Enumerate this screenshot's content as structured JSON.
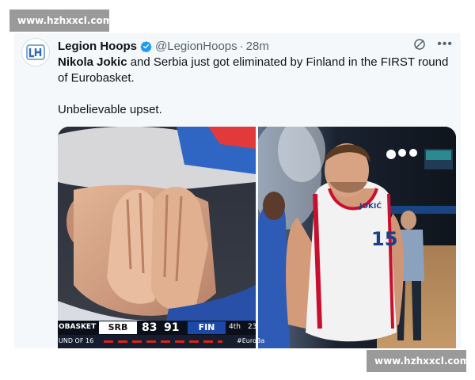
{
  "watermarks": {
    "top": "www.hzhxxcl.com",
    "bottom": "www.hzhxxcl.com"
  },
  "tweet": {
    "author_name": "Legion Hoops",
    "handle": "@LegionHoops",
    "separator": "·",
    "time": "28m",
    "text_bold": "Nikola Jokic",
    "text_rest": " and Serbia just got eliminated by Finland in the FIRST round of Eurobasket.",
    "text_second": "Unbelievable upset."
  },
  "scorebug": {
    "event": "OBASKET",
    "home_team": "SRB",
    "home_score": "83",
    "away_score": "91",
    "away_team": "FIN",
    "quarter": "4th",
    "clock": "23",
    "round": "UND OF 16",
    "tag": "#EuroBa"
  },
  "jersey": {
    "number": "15",
    "name": "JOKIĆ"
  },
  "colors": {
    "verified_blue": "#1d9bf0",
    "handle_gray": "#536471",
    "text_dark": "#0f1419",
    "serbia_red": "#c8102e",
    "finland_blue": "#1c49a8"
  },
  "icons": [
    "verified-badge-icon",
    "grok-icon",
    "more-options-icon",
    "legion-hoops-logo"
  ]
}
